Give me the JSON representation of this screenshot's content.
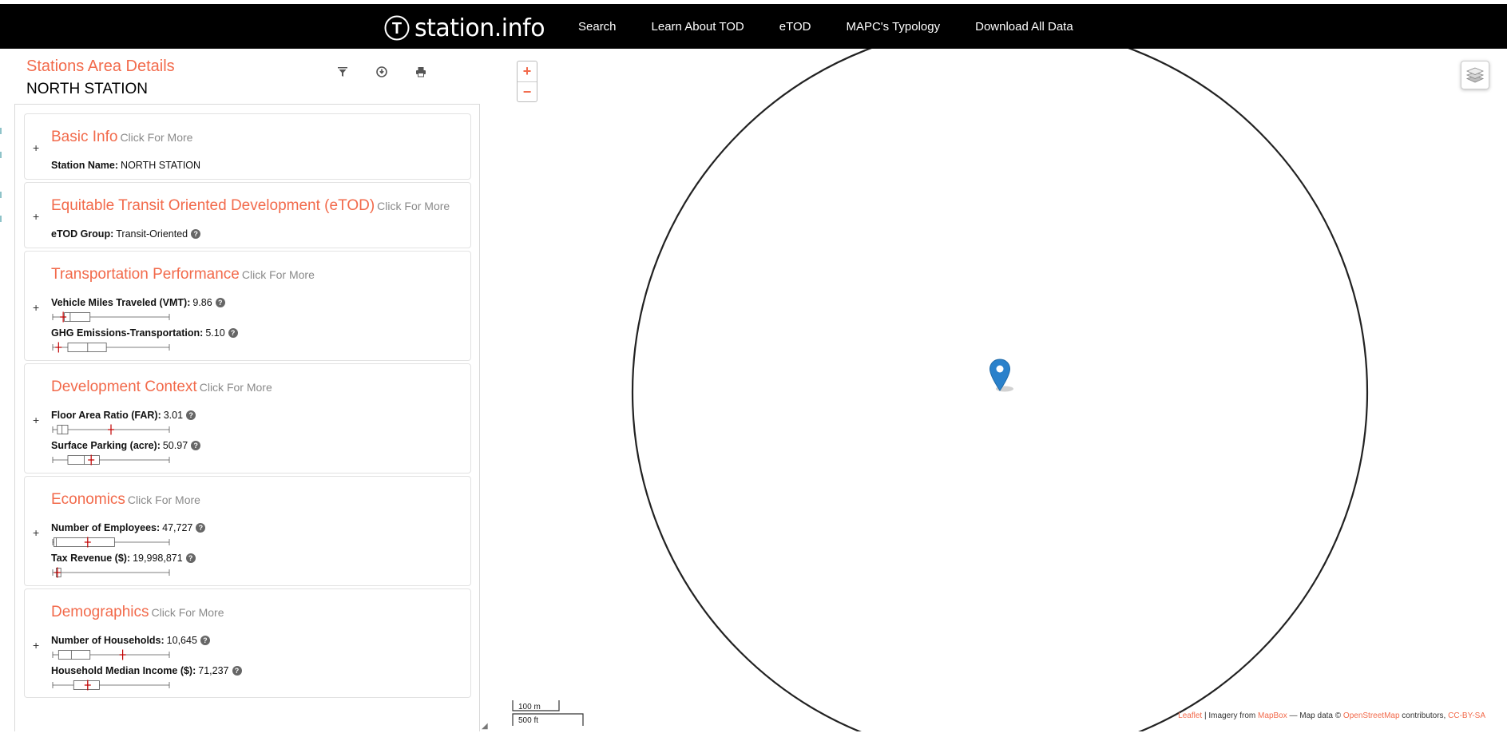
{
  "header": {
    "logo_letter": "T",
    "brand": "station.info",
    "nav": [
      "Search",
      "Learn About TOD",
      "eTOD",
      "MAPC's Typology",
      "Download All Data"
    ]
  },
  "panel": {
    "title": "Stations Area Details",
    "station": "NORTH STATION",
    "tools": [
      "filter-icon",
      "download-icon",
      "print-icon"
    ]
  },
  "cards": [
    {
      "title": "Basic Info",
      "more": "Click For More",
      "metrics": [
        {
          "label": "Station Name:",
          "value": "NORTH STATION",
          "help": false
        }
      ]
    },
    {
      "title": "Equitable Transit Oriented Development (eTOD)",
      "more": "Click For More",
      "metrics": [
        {
          "label": "eTOD Group:",
          "value": "Transit-Oriented",
          "help": true
        }
      ]
    },
    {
      "title": "Transportation Performance",
      "more": "Click For More",
      "metrics": [
        {
          "label": "Vehicle Miles Traveled (VMT):",
          "value": "9.86",
          "help": true
        },
        {
          "label": "GHG Emissions-Transportation:",
          "value": "5.10",
          "help": true
        }
      ]
    },
    {
      "title": "Development Context",
      "more": "Click For More",
      "metrics": [
        {
          "label": "Floor Area Ratio (FAR):",
          "value": "3.01",
          "help": true
        },
        {
          "label": "Surface Parking (acre):",
          "value": "50.97",
          "help": true
        }
      ]
    },
    {
      "title": "Economics",
      "more": "Click For More",
      "metrics": [
        {
          "label": "Number of Employees:",
          "value": "47,727",
          "help": true
        },
        {
          "label": "Tax Revenue ($):",
          "value": "19,998,871",
          "help": true
        }
      ]
    },
    {
      "title": "Demographics",
      "more": "Click For More",
      "metrics": [
        {
          "label": "Number of Households:",
          "value": "10,645",
          "help": true
        },
        {
          "label": "Household Median Income ($):",
          "value": "71,237",
          "help": true
        }
      ]
    }
  ],
  "boxplots": [
    {
      "min": 0.0,
      "q1": 0.1,
      "median": 0.15,
      "q3": 0.32,
      "max": 1.0,
      "marker": 0.09
    },
    {
      "min": 0.0,
      "q1": 0.13,
      "median": 0.3,
      "q3": 0.46,
      "max": 1.0,
      "marker": 0.05
    },
    {
      "min": 0.0,
      "q1": 0.04,
      "median": 0.08,
      "q3": 0.13,
      "max": 1.0,
      "marker": 0.5
    },
    {
      "min": 0.0,
      "q1": 0.13,
      "median": 0.27,
      "q3": 0.4,
      "max": 1.0,
      "marker": 0.33
    },
    {
      "min": 0.0,
      "q1": 0.01,
      "median": 0.03,
      "q3": 0.53,
      "max": 1.0,
      "marker": 0.3
    },
    {
      "min": 0.0,
      "q1": 0.03,
      "median": 0.04,
      "q3": 0.07,
      "max": 1.0,
      "marker": 0.04
    },
    {
      "min": 0.0,
      "q1": 0.05,
      "median": 0.16,
      "q3": 0.32,
      "max": 1.0,
      "marker": 0.6
    },
    {
      "min": 0.0,
      "q1": 0.18,
      "median": 0.3,
      "q3": 0.4,
      "max": 1.0,
      "marker": 0.3
    }
  ],
  "map": {
    "zoom_in": "+",
    "zoom_out": "−",
    "scale_metric": "100 m",
    "scale_imperial": "500 ft",
    "attribution": {
      "leaflet": "Leaflet",
      "sep": " | Imagery from ",
      "mapbox": "MapBox",
      "mid": " — Map data © ",
      "osm": "OpenStreetMap",
      "contrib": " contributors, ",
      "license": "CC-BY-SA"
    }
  },
  "colors": {
    "accent": "#f26a4b",
    "nav_bg": "#000000",
    "marker": "#2a81cb"
  }
}
